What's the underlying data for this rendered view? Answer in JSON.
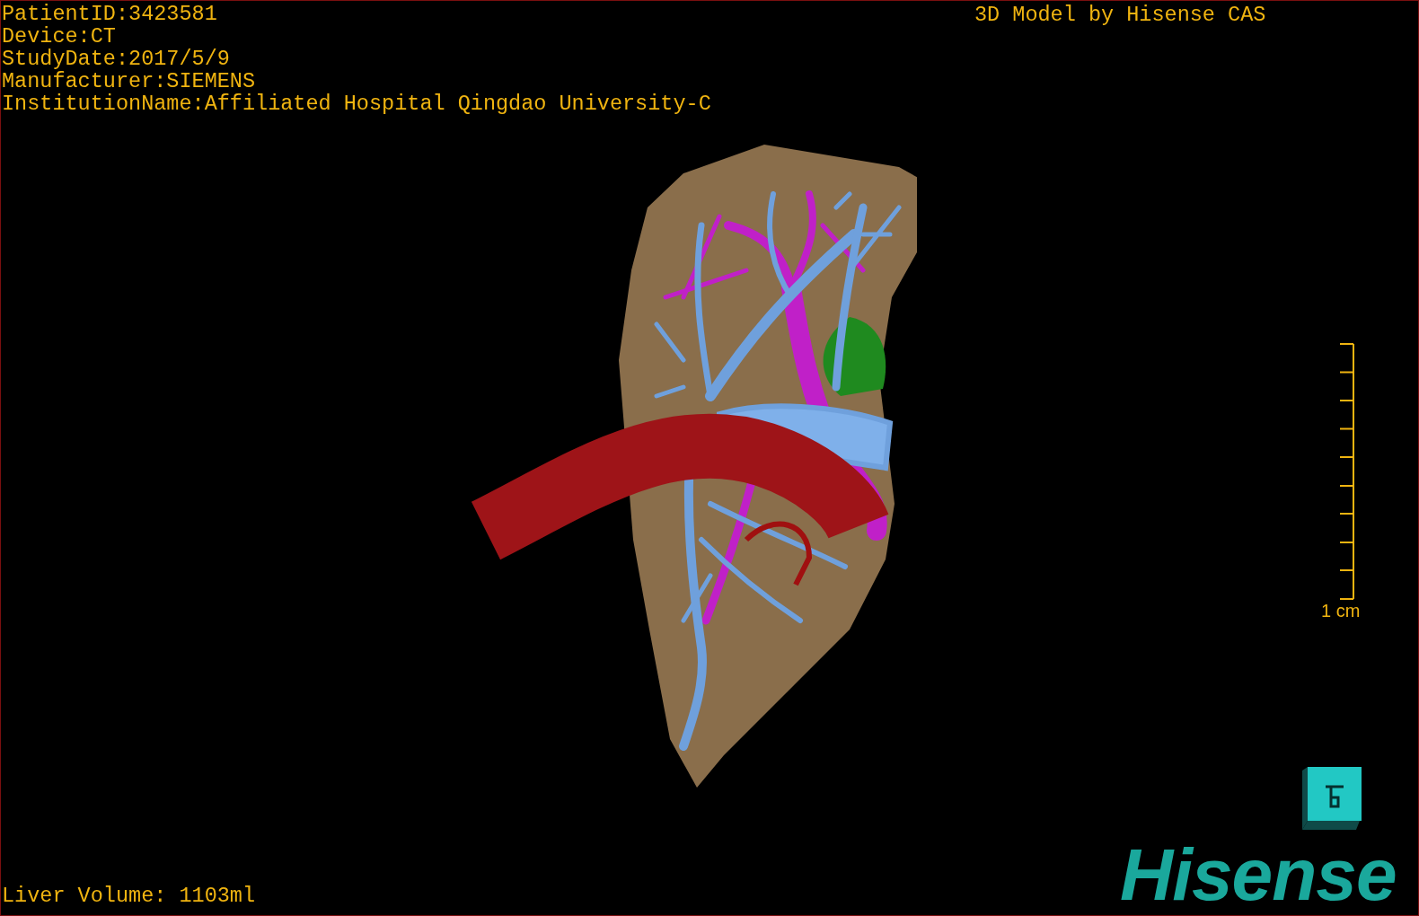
{
  "study_info": [
    "PatientID:3423581",
    "Device:CT",
    "StudyDate:2017/5/9",
    "Manufacturer:SIEMENS",
    "InstitutionName:Affiliated Hospital Qingdao University-C"
  ],
  "credit": "3D Model by Hisense CAS",
  "scale_bar": {
    "label": "1 cm"
  },
  "liver_volume": "Liver Volume: 1103ml",
  "logo": "Hisense"
}
